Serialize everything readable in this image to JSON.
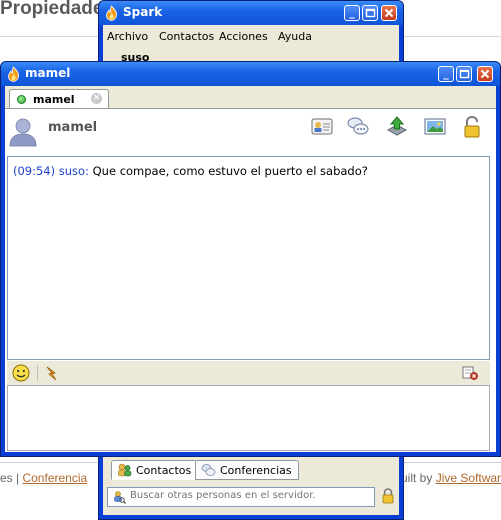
{
  "background_page": {
    "title": "Propiedades",
    "footer_left_sep": "es  |  ",
    "footer_left_link": "Conferencia",
    "footer_right_text": "uilt by ",
    "footer_right_link": "Jive Softwar"
  },
  "spark_window": {
    "title": "Spark",
    "menu": [
      "Archivo",
      "Contactos",
      "Acciones",
      "Ayuda"
    ],
    "username": "suso",
    "tabs": [
      {
        "label": "Contactos",
        "icon": "contacts-icon"
      },
      {
        "label": "Conferencias",
        "icon": "conferences-icon"
      }
    ],
    "search_placeholder": "Buscar otras personas en el servidor."
  },
  "chat_window": {
    "title": "mamel",
    "tab_label": "mamel",
    "contact_name": "mamel",
    "status_color": "#2ea02e",
    "toolbar_icons": [
      "vcard-icon",
      "chat-bubbles-icon",
      "file-transfer-icon",
      "screenshot-icon",
      "lock-icon"
    ],
    "messages": [
      {
        "time": "(09:54)",
        "sender": "suso:",
        "text": " Que compae, como estuvo el puerto el sabado?"
      }
    ],
    "edit_toolbar_icons": [
      "emoticon-icon",
      "buzz-icon",
      "clear-icon"
    ]
  },
  "colors": {
    "title_bar": "#1a63e6",
    "close_button": "#c63b1b",
    "window_face": "#ece9d8",
    "message_meta": "#1e40c8",
    "link": "#b06a2c"
  }
}
